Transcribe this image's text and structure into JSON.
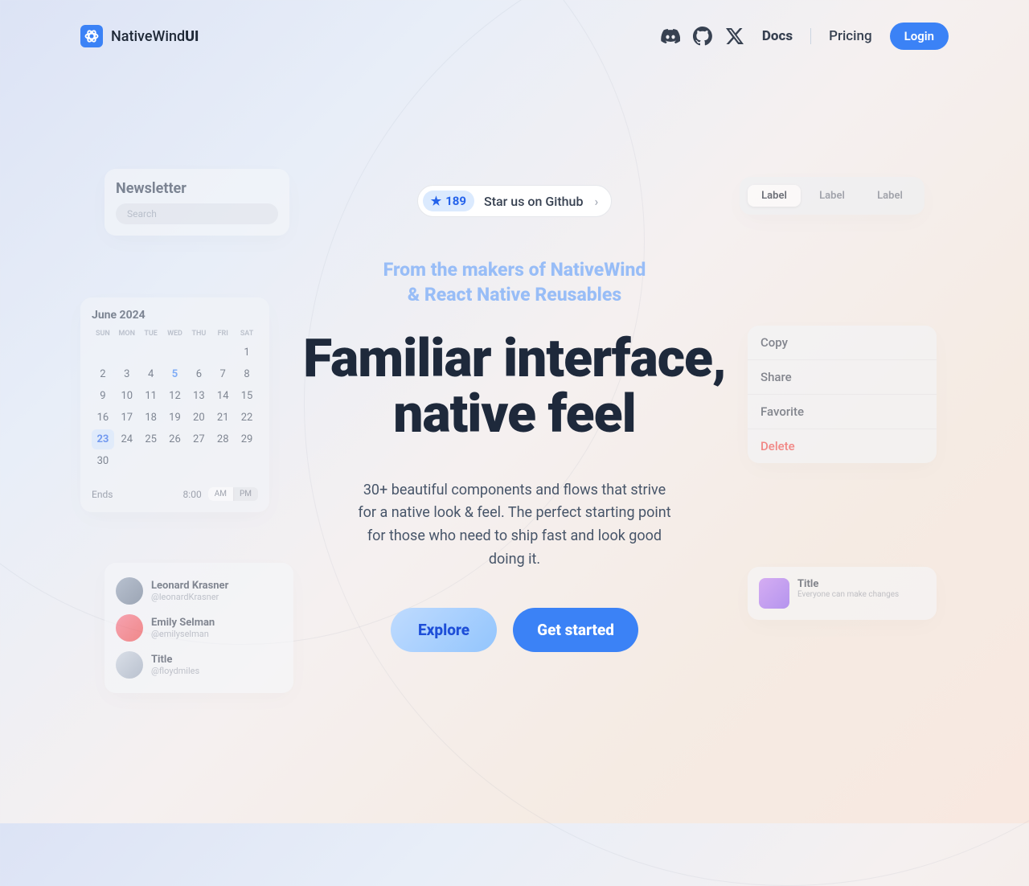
{
  "brand_a": "NativeWind",
  "brand_b": "UI",
  "nav": {
    "docs": "Docs",
    "pricing": "Pricing",
    "login": "Login"
  },
  "star": {
    "count": "189",
    "label": "Star us on Github"
  },
  "tagline_1": "From the makers of NativeWind",
  "tagline_2": "& React Native Reusables",
  "headline_1": "Familiar interface,",
  "headline_2": "native feel",
  "subtext": "30+ beautiful components and flows that strive for a native look & feel. The perfect starting point for those who need to ship fast and look good doing it.",
  "cta": {
    "explore": "Explore",
    "start": "Get started"
  },
  "newsletter": {
    "title": "Newsletter",
    "placeholder": "Search"
  },
  "segments": [
    "Label",
    "Label",
    "Label"
  ],
  "calendar": {
    "month": "June 2024",
    "dow": [
      "SUN",
      "MON",
      "TUE",
      "WED",
      "THU",
      "FRI",
      "SAT"
    ],
    "ends": "Ends",
    "time": "8:00",
    "am": "AM",
    "pm": "PM"
  },
  "menu": [
    "Copy",
    "Share",
    "Favorite",
    "Delete"
  ],
  "people": [
    {
      "name": "Leonard Krasner",
      "handle": "@leonardKrasner"
    },
    {
      "name": "Emily Selman",
      "handle": "@emilyselman"
    },
    {
      "name": "Title",
      "handle": "@floydmiles"
    }
  ],
  "card": {
    "title": "Title",
    "sub": "Everyone can make changes"
  }
}
